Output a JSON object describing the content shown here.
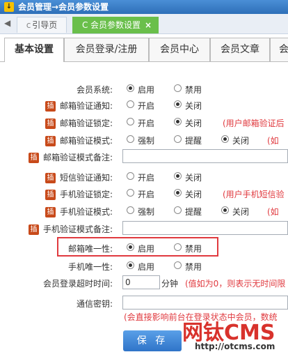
{
  "titlebar": {
    "icon": "download-icon",
    "text": "会员管理→会员参数设置"
  },
  "tabs": {
    "back_arrow": "◀",
    "tab1": {
      "icon": "c",
      "label": "引导页"
    },
    "tab2": {
      "icon": "C",
      "label": "会员参数设置",
      "close": "×"
    }
  },
  "subtabs": [
    "基本设置",
    "会员登录/注册",
    "会员中心",
    "会员文章",
    "会"
  ],
  "badge": "插",
  "radio_labels": {
    "on": "启用",
    "off": "禁用",
    "open": "开启",
    "close": "关闭",
    "force": "强制",
    "remind": "提醒"
  },
  "rows": {
    "member_system": {
      "label": "会员系统:",
      "selected": "启用"
    },
    "mail_notify": {
      "label": "邮箱验证通知:",
      "selected": "关闭"
    },
    "mail_lock": {
      "label": "邮箱验证锁定:",
      "selected": "关闭",
      "note": "(用户邮箱验证后"
    },
    "mail_mode": {
      "label": "邮箱验证模式:",
      "selected": "关闭",
      "note": "(如"
    },
    "mail_mode_note": {
      "label": "邮箱验证模式备注:"
    },
    "sms_notify": {
      "label": "短信验证通知:",
      "selected": "关闭"
    },
    "phone_lock": {
      "label": "手机验证锁定:",
      "selected": "关闭",
      "note": "(用户手机短信验"
    },
    "phone_mode": {
      "label": "手机验证模式:",
      "selected": "关闭",
      "note": "(如"
    },
    "phone_mode_note": {
      "label": "手机验证模式备注:"
    },
    "mail_unique": {
      "label": "邮箱唯一性:",
      "selected": "启用"
    },
    "phone_unique": {
      "label": "手机唯一性:",
      "selected": "启用"
    },
    "login_timeout": {
      "label": "会员登录超时时间:",
      "value": "0",
      "unit": "分钟",
      "note": "(值如为0，则表示无时间限"
    },
    "comm_key": {
      "label": "通信密钥:",
      "note": "(会直接影响前台在登录状态中会员，数统"
    }
  },
  "save_label": "保 存",
  "watermark": {
    "brand": "网钛CMS",
    "url": "http://otcms.com"
  },
  "colors": {
    "title_bg": "#2e6fb8",
    "tab_active": "#6abf4b",
    "note": "#e0393e",
    "badge": "#c84a1a"
  }
}
